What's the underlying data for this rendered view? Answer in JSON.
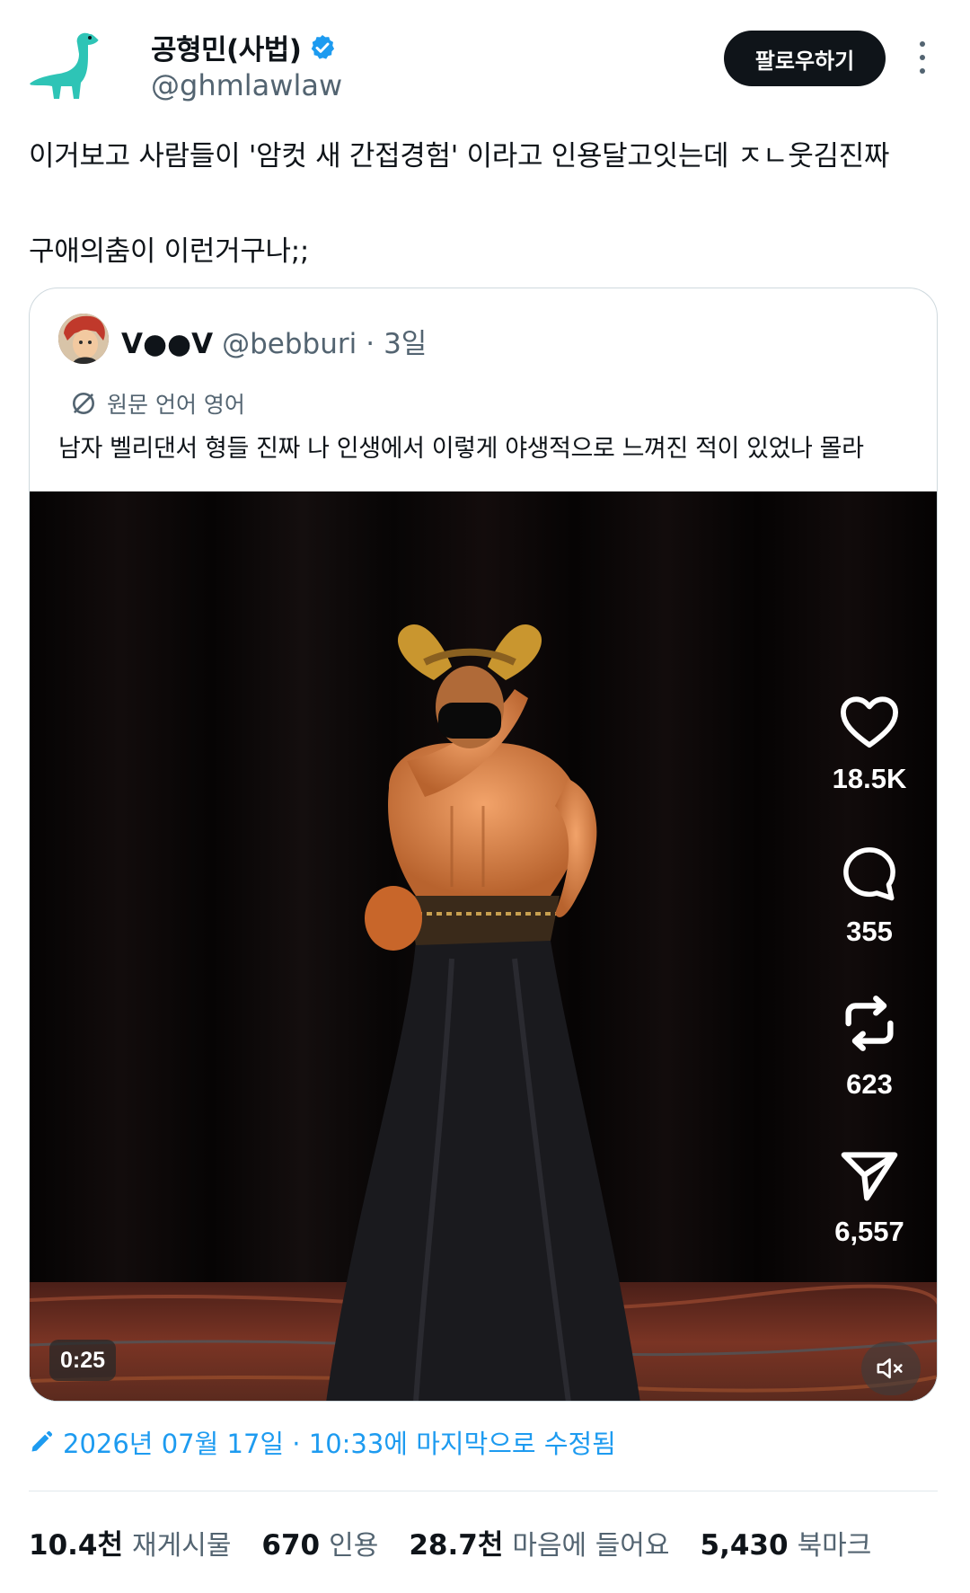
{
  "header": {
    "display_name": "공형민(사법)",
    "handle": "@ghmlawlaw",
    "follow_label": "팔로우하기"
  },
  "tweet": {
    "line1": "이거보고 사람들이 '암컷 새 간접경험' 이라고 인용달고잇는데 ㅈㄴ웃김진짜",
    "line2": "구애의춤이 이런거구나;;"
  },
  "quote": {
    "name": "V●●V",
    "handle": "@bebburi",
    "separator": "·",
    "time": "3일",
    "translate_label": "원문 언어 영어",
    "text": "남자 벨리댄서 형들 진짜 나 인생에서 이렇게 야생적으로 느껴진 적이 있었나 몰라"
  },
  "video": {
    "actions": [
      {
        "icon": "heart-icon",
        "count": "18.5K"
      },
      {
        "icon": "comment-icon",
        "count": "355"
      },
      {
        "icon": "repost-icon",
        "count": "623"
      },
      {
        "icon": "share-icon",
        "count": "6,557"
      }
    ],
    "timestamp": "0:25"
  },
  "edit_info": "2026년 07월 17일 · 10:33에 마지막으로 수정됨",
  "stats": [
    {
      "value": "10.4천",
      "label": "재게시물"
    },
    {
      "value": "670",
      "label": "인용"
    },
    {
      "value": "28.7천",
      "label": "마음에 들어요"
    },
    {
      "value": "5,430",
      "label": "북마크"
    }
  ],
  "colors": {
    "accent": "#1d9bf0",
    "text": "#0f1419",
    "muted": "#536471",
    "border": "#cfd9de"
  }
}
